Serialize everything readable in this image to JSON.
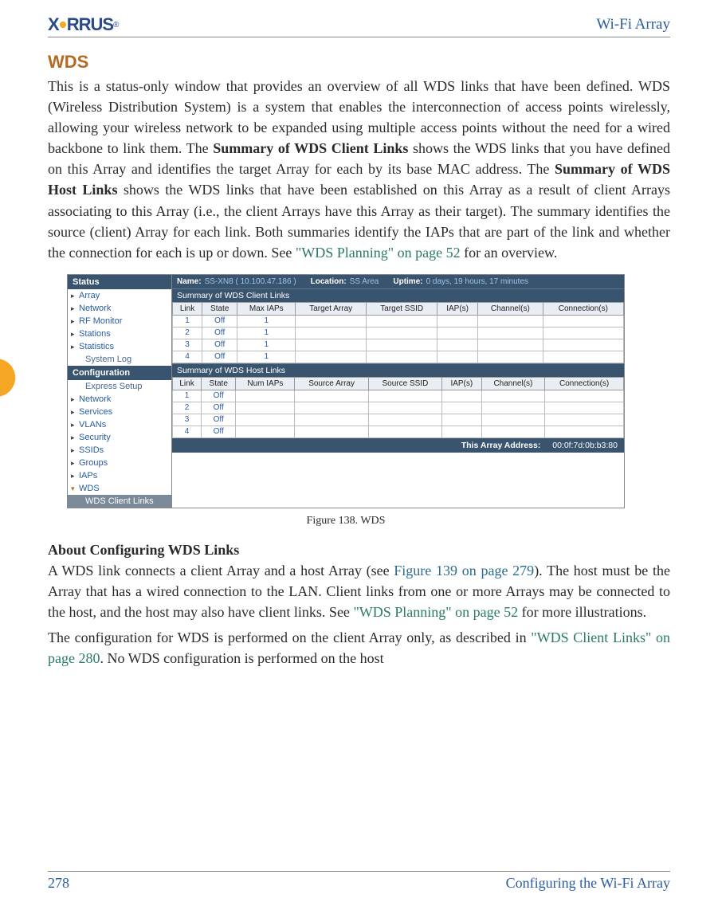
{
  "header": {
    "brand_part1": "X",
    "brand_part2": "RRUS",
    "doc_title": "Wi-Fi Array"
  },
  "section": {
    "title": "WDS",
    "para1_a": "This is a status-only window that provides an overview of all WDS links that have been defined. WDS (Wireless Distribution System) is a system that enables the interconnection of access points wirelessly, allowing your wireless network to be expanded using multiple access points without the need for a wired backbone to link them. The ",
    "para1_b": "Summary of WDS Client Links",
    "para1_c": " shows the WDS links that you have defined on this Array and identifies the target Array for each by its base MAC address. The ",
    "para1_d": "Summary of WDS Host Links",
    "para1_e": " shows the WDS links that have been established on this Array as a result of client Arrays associating to this Array (i.e., the client Arrays have this Array as their target). The summary identifies the source (client) Array for each link. Both summaries identify the IAPs that are part of the link and whether the connection for each is up or down. See ",
    "para1_link": "\"WDS Planning\" on page 52",
    "para1_f": " for an overview."
  },
  "figure": {
    "caption": "Figure 138. WDS",
    "statusbar": {
      "name_lbl": "Name:",
      "name_val": "SS-XN8   ( 10.100.47.186 )",
      "loc_lbl": "Location:",
      "loc_val": "SS Area",
      "up_lbl": "Uptime:",
      "up_val": "0 days, 19 hours, 17 minutes"
    },
    "sidebar": {
      "header1": "Status",
      "items1": [
        "Array",
        "Network",
        "RF Monitor",
        "Stations",
        "Statistics",
        "System Log"
      ],
      "header2": "Configuration",
      "items2": [
        "Express Setup",
        "Network",
        "Services",
        "VLANs",
        "Security",
        "SSIDs",
        "Groups",
        "IAPs",
        "WDS",
        "WDS Client Links"
      ]
    },
    "client_table_title": "Summary of WDS Client Links",
    "client_cols": [
      "Link",
      "State",
      "Max IAPs",
      "Target Array",
      "Target SSID",
      "IAP(s)",
      "Channel(s)",
      "Connection(s)"
    ],
    "client_rows": [
      {
        "link": "1",
        "state": "Off",
        "max": "1"
      },
      {
        "link": "2",
        "state": "Off",
        "max": "1"
      },
      {
        "link": "3",
        "state": "Off",
        "max": "1"
      },
      {
        "link": "4",
        "state": "Off",
        "max": "1"
      }
    ],
    "host_table_title": "Summary of WDS Host Links",
    "host_cols": [
      "Link",
      "State",
      "Num IAPs",
      "Source Array",
      "Source SSID",
      "IAP(s)",
      "Channel(s)",
      "Connection(s)"
    ],
    "host_rows": [
      {
        "link": "1",
        "state": "Off"
      },
      {
        "link": "2",
        "state": "Off"
      },
      {
        "link": "3",
        "state": "Off"
      },
      {
        "link": "4",
        "state": "Off"
      }
    ],
    "footer_lbl": "This Array Address:",
    "footer_val": "00:0f:7d:0b:b3:80"
  },
  "about": {
    "heading": "About Configuring WDS Links",
    "p1_a": "A WDS link connects a client Array and a host Array (see ",
    "p1_link": "Figure 139 on page 279",
    "p1_b": "). The host must be the Array that has a wired connection to the LAN. Client links from one or more Arrays may be connected to the host, and the host may also have client links. See ",
    "p1_link2": "\"WDS Planning\" on page 52",
    "p1_c": " for more illustrations.",
    "p2_a": "The configuration for WDS is performed on the client Array only, as described in ",
    "p2_link": "\"WDS Client Links\" on page 280",
    "p2_b": ". No WDS configuration is performed on the host"
  },
  "footer": {
    "page": "278",
    "chapter": "Configuring the Wi-Fi Array"
  }
}
